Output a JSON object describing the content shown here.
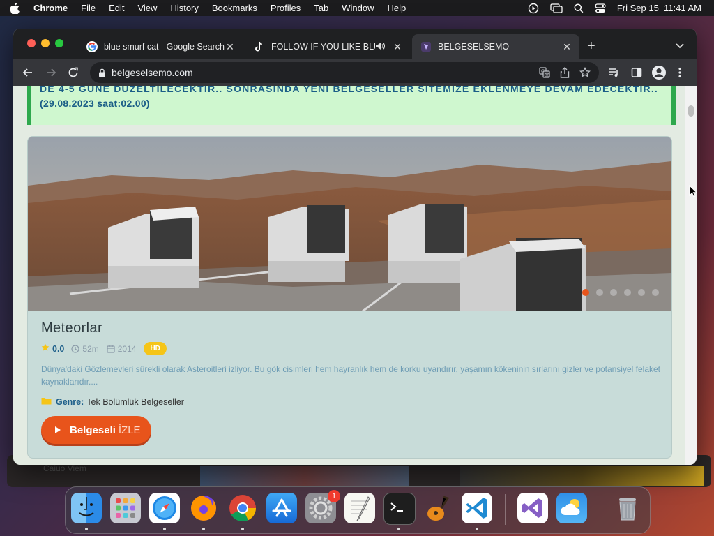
{
  "menubar": {
    "app_name": "Chrome",
    "items": [
      "File",
      "Edit",
      "View",
      "History",
      "Bookmarks",
      "Profiles",
      "Tab",
      "Window",
      "Help"
    ],
    "datetime": "Fri Sep 15  11:41 AM"
  },
  "tabs": [
    {
      "title": "blue smurf cat - Google Search",
      "favicon": "google-icon"
    },
    {
      "title": "FOLLOW IF YOU LIKE BLUE",
      "favicon": "tiktok-icon"
    },
    {
      "title": "BELGESELSEMO",
      "favicon": "belgeselsemo-icon",
      "active": true
    }
  ],
  "address_bar": {
    "url": "belgeselsemo.com"
  },
  "notice": {
    "line1": "DE 4-5 GÜNE DÜZELTİLECEKTİR.. SONRASINDA YENİ BELGESELLER SİTEMİZE EKLENMEYE DEVAM EDECEKTİR..",
    "line2": "(29.08.2023 saat:02.00)"
  },
  "documentary": {
    "title": "Meteorlar",
    "rating": "0.0",
    "duration": "52m",
    "year": "2014",
    "quality": "HD",
    "description": "Dünya'daki Gözlemevleri sürekli olarak Asteroitleri izliyor. Bu gök cisimleri hem hayranlık hem de korku uyandırır, yaşamın kökeninin sırlarını gizler ve potansiyel felaket kaynaklarıdır....",
    "genre_label": "Genre:",
    "genre_value": "Tek Bölümlük Belgeseller",
    "watch_bold": "Belgeseli",
    "watch_light": "İZLE"
  },
  "slider": {
    "dot_count": 6,
    "active_index": 0
  },
  "background_window_text": "Caiuo Viem",
  "dock": {
    "apps": [
      "finder",
      "launchpad",
      "safari",
      "firefox",
      "chrome",
      "app-store",
      "system-settings",
      "textedit",
      "terminal",
      "garageband",
      "vscode",
      "visual-studio",
      "weather",
      "trash"
    ],
    "system_settings_badge": "1"
  },
  "colors": {
    "accent_orange": "#e8541b",
    "notice_blue": "#1a5d87",
    "notice_green": "#2ea84d",
    "card_bg": "#c8dcd9",
    "hd_yellow": "#f5c518"
  }
}
